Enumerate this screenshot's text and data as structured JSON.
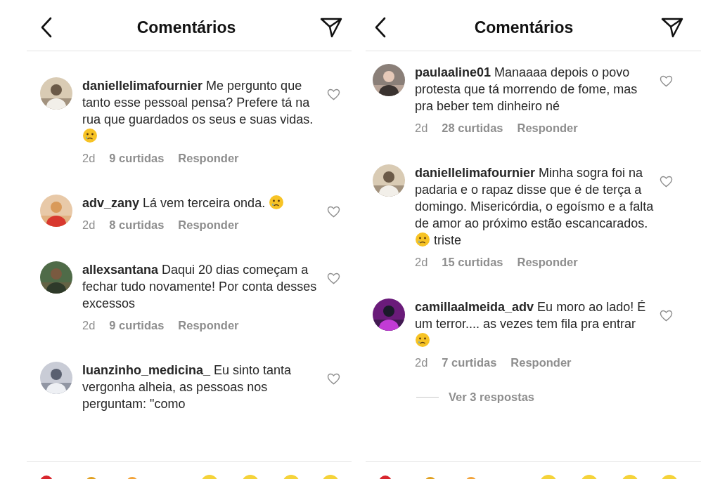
{
  "panels": [
    {
      "header": {
        "title": "Comentários"
      },
      "comments": [
        {
          "segments": [
            {
              "kind": "text",
              "text": "**daniellelimafournier** Me pergunto que tanto esse pessoal pensa? Prefere tá na rua que guardados os seus e suas vidas."
            },
            {
              "kind": "emoji"
            }
          ],
          "time": "2d",
          "likes": "9 curtidas",
          "reply": "Responder",
          "liked": false
        },
        {
          "segments": [
            {
              "kind": "text",
              "text": "**adv_zany** Lá vem terceira onda."
            },
            {
              "kind": "emoji"
            }
          ],
          "time": "2d",
          "likes": "8 curtidas",
          "reply": "Responder",
          "liked": false
        },
        {
          "segments": [
            {
              "kind": "text",
              "text": "**allexsantana** Daqui 20 dias começam a fechar tudo novamente! Por conta desses excessos"
            }
          ],
          "time": "2d",
          "likes": "9 curtidas",
          "reply": "Responder",
          "liked": false
        },
        {
          "segments": [
            {
              "kind": "text",
              "text": "**luanzinho_medicina_** Eu sinto tanta vergonha alheia, as pessoas nos perguntam: \"como"
            }
          ],
          "liked": false
        }
      ]
    },
    {
      "header": {
        "title": "Comentários"
      },
      "comments": [
        {
          "segments": [
            {
              "kind": "text",
              "text": "**paulaaline01** Manaaaa depois o povo protesta que tá morrendo de fome, mas pra beber tem dinheiro né"
            }
          ],
          "time": "2d",
          "likes": "28 curtidas",
          "reply": "Responder",
          "liked": false
        },
        {
          "segments": [
            {
              "kind": "text",
              "text": "**daniellelimafournier** Minha sogra foi na padaria e o rapaz disse que é de terça a domingo. Misericórdia, o egoísmo e a falta de amor ao próximo estão escancarados."
            },
            {
              "kind": "emoji"
            },
            {
              "kind": "text",
              "text": "triste"
            }
          ],
          "time": "2d",
          "likes": "15 curtidas",
          "reply": "Responder",
          "liked": false
        },
        {
          "segments": [
            {
              "kind": "text",
              "text": "**camillaalmeida_adv** Eu moro ao lado! É um terror.... as vezes tem fila pra entrar"
            },
            {
              "kind": "emoji"
            }
          ],
          "time": "2d",
          "likes": "7 curtidas",
          "reply": "Responder",
          "liked": false
        }
      ],
      "view_replies": {
        "label": "Ver 3 respostas"
      }
    }
  ]
}
